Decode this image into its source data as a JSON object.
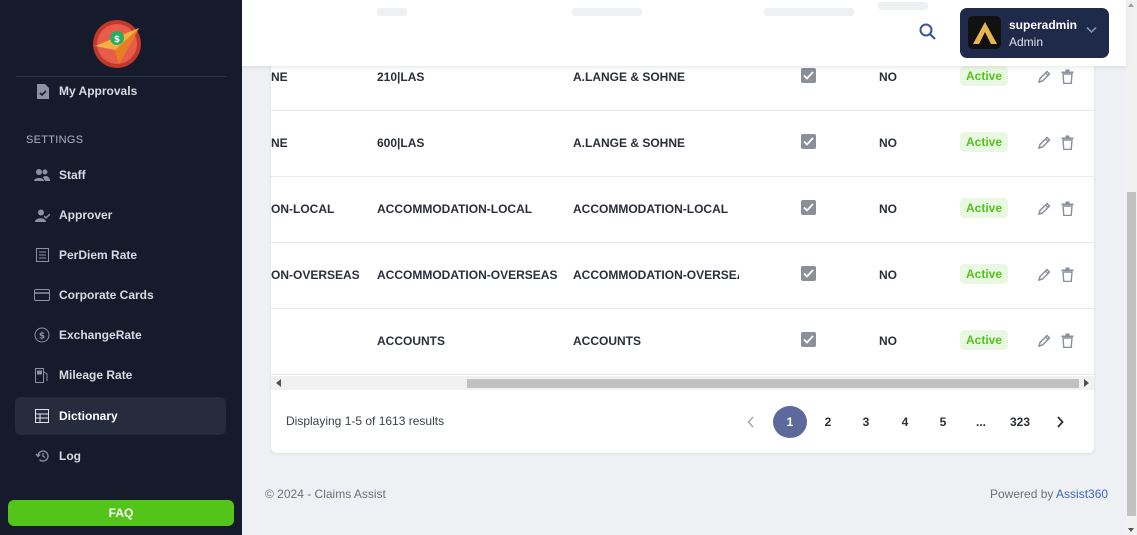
{
  "sidebar": {
    "brand_colors": {
      "ring": "#c0392b",
      "plane": "#e67e22",
      "coin": "#27ae60"
    },
    "items_top": [
      {
        "label": "My Approvals",
        "icon": "approval-doc-icon"
      }
    ],
    "section_label": "SETTINGS",
    "items": [
      {
        "label": "Staff",
        "icon": "people-icon"
      },
      {
        "label": "Approver",
        "icon": "user-check-icon"
      },
      {
        "label": "PerDiem Rate",
        "icon": "list-icon"
      },
      {
        "label": "Corporate Cards",
        "icon": "card-icon"
      },
      {
        "label": "ExchangeRate",
        "icon": "exchange-icon"
      },
      {
        "label": "Mileage Rate",
        "icon": "fuel-icon"
      },
      {
        "label": "Dictionary",
        "icon": "table-icon",
        "active": true
      },
      {
        "label": "Log",
        "icon": "history-icon"
      }
    ],
    "faq_label": "FAQ"
  },
  "header": {
    "user": {
      "name": "superadmin",
      "role": "Admin"
    }
  },
  "table": {
    "rows": [
      {
        "col1": "NE",
        "col2": "210|LAS",
        "col3": "A.LANGE & SOHNE",
        "checked": true,
        "col5": "NO",
        "status": "Active"
      },
      {
        "col1": "NE",
        "col2": "600|LAS",
        "col3": "A.LANGE & SOHNE",
        "checked": true,
        "col5": "NO",
        "status": "Active"
      },
      {
        "col1": "ON-LOCAL",
        "col2": "ACCOMMODATION-LOCAL",
        "col3": "ACCOMMODATION-LOCAL",
        "checked": true,
        "col5": "NO",
        "status": "Active"
      },
      {
        "col1": "ON-OVERSEAS",
        "col2": "ACCOMMODATION-OVERSEAS",
        "col3": "ACCOMMODATION-OVERSEAS",
        "checked": true,
        "col5": "NO",
        "status": "Active"
      },
      {
        "col1": "",
        "col2": "ACCOUNTS",
        "col3": "ACCOUNTS",
        "checked": true,
        "col5": "NO",
        "status": "Active"
      }
    ]
  },
  "pagination": {
    "summary": "Displaying 1-5 of 1613 results",
    "pages": [
      "1",
      "2",
      "3",
      "4",
      "5",
      "...",
      "323"
    ],
    "current": "1"
  },
  "footer": {
    "copyright": "© 2024 - Claims Assist",
    "powered_prefix": "Powered by ",
    "powered_link": "Assist360"
  },
  "colors": {
    "active_green": "#52c41a",
    "sidebar_bg": "#161b2c",
    "user_chip_bg": "#1f2a4a",
    "current_page": "#5b6a9a"
  }
}
